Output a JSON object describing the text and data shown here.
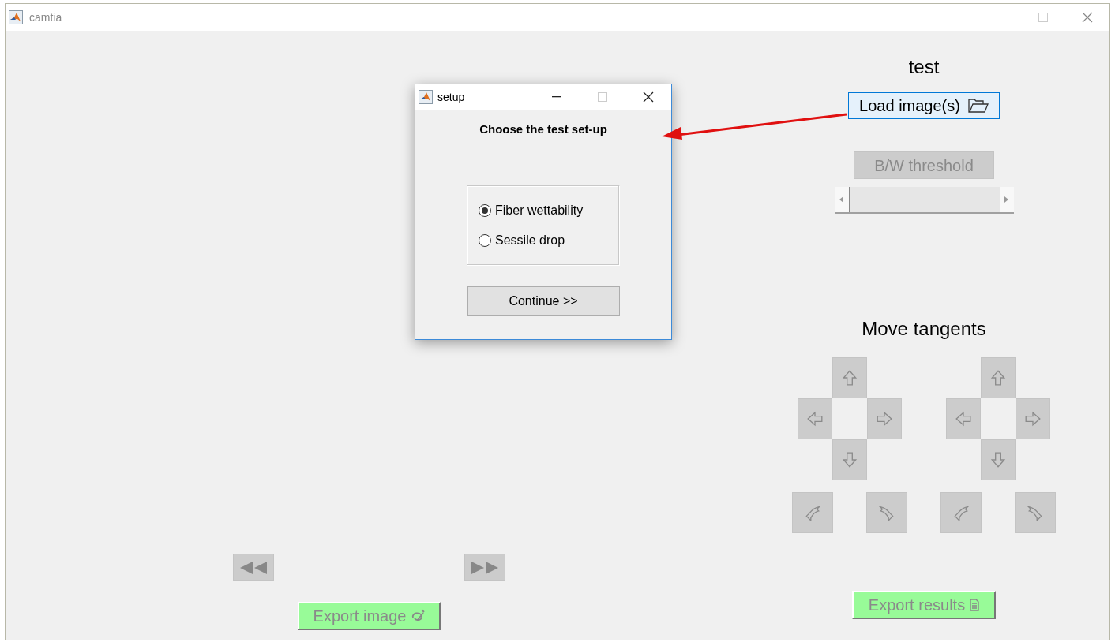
{
  "window": {
    "title": "camtia"
  },
  "panel": {
    "title": "test",
    "load_button": {
      "label": "Load image(s)",
      "focused": true
    },
    "threshold_button": {
      "label": "B/W threshold",
      "disabled": true
    },
    "threshold_slider": {
      "level": 0
    },
    "tangents_title": "Move tangents",
    "tangent_pads": [
      {
        "disabled": true
      },
      {
        "disabled": true
      }
    ],
    "export_results": {
      "label": "Export results",
      "disabled": true
    }
  },
  "navigation": {
    "previous": {
      "disabled": true
    },
    "next": {
      "disabled": true
    }
  },
  "export_image": {
    "label": "Export image",
    "disabled": true
  },
  "dialog": {
    "title": "setup",
    "heading": "Choose the test set-up",
    "options": [
      {
        "label": "Fiber wettability",
        "selected": true
      },
      {
        "label": "Sessile drop",
        "selected": false
      }
    ],
    "button": "Continue >>"
  }
}
